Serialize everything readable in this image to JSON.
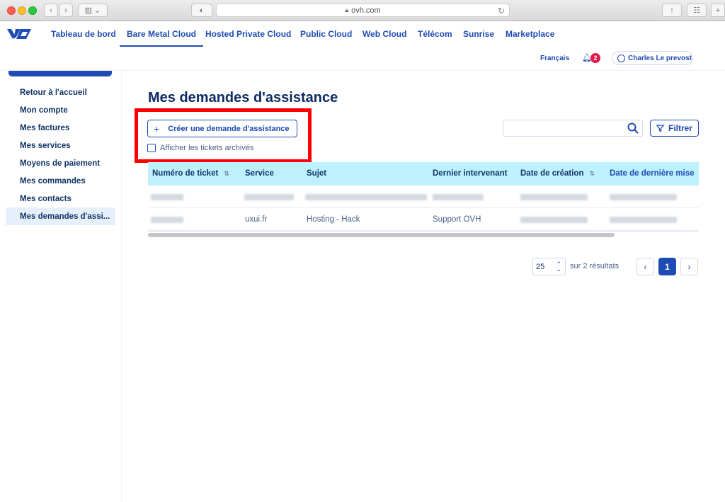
{
  "browser": {
    "url": "ovh.com"
  },
  "nav": {
    "items": [
      {
        "label": "Tableau de bord"
      },
      {
        "label": "Bare Metal Cloud"
      },
      {
        "label": "Hosted Private Cloud"
      },
      {
        "label": "Public Cloud"
      },
      {
        "label": "Web Cloud"
      },
      {
        "label": "Télécom"
      },
      {
        "label": "Sunrise"
      },
      {
        "label": "Marketplace"
      }
    ],
    "active": "Bare Metal Cloud"
  },
  "header": {
    "language": "Français",
    "notifications_count": "2",
    "user_name": "Charles Le prevost"
  },
  "sidebar": {
    "items": [
      {
        "label": "Retour à l'accueil"
      },
      {
        "label": "Mon compte"
      },
      {
        "label": "Mes factures"
      },
      {
        "label": "Mes services"
      },
      {
        "label": "Moyens de paiement"
      },
      {
        "label": "Mes commandes"
      },
      {
        "label": "Mes contacts"
      },
      {
        "label": "Mes demandes d'assi..."
      }
    ],
    "active": "Mes demandes d'assi..."
  },
  "main": {
    "title": "Mes demandes d'assistance",
    "create_button": "Créer une demande d'assistance",
    "archived_checkbox_label": "Afficher les tickets archivés",
    "archived_checked": false,
    "search_value": "",
    "filter_button": "Filtrer"
  },
  "table": {
    "headers": [
      "Numéro de ticket",
      "Service",
      "Sujet",
      "Dernier intervenant",
      "Date de création",
      "Date de dernière mise"
    ],
    "rows": [
      {
        "ticket": "",
        "service": "",
        "subject": "",
        "last_agent": "",
        "created": "",
        "updated": ""
      },
      {
        "ticket": "",
        "service": "uxui.fr",
        "subject": "Hosting - Hack",
        "last_agent": "Support OVH",
        "created": "",
        "updated": ""
      }
    ]
  },
  "pagination": {
    "page_size": "25",
    "results_text": "sur 2 résultats",
    "current_page": "1"
  },
  "colors": {
    "brand": "#1f4bb5",
    "title": "#0d2a63",
    "table_header_bg": "#bef1ff",
    "highlight_box": "#ff0000"
  }
}
